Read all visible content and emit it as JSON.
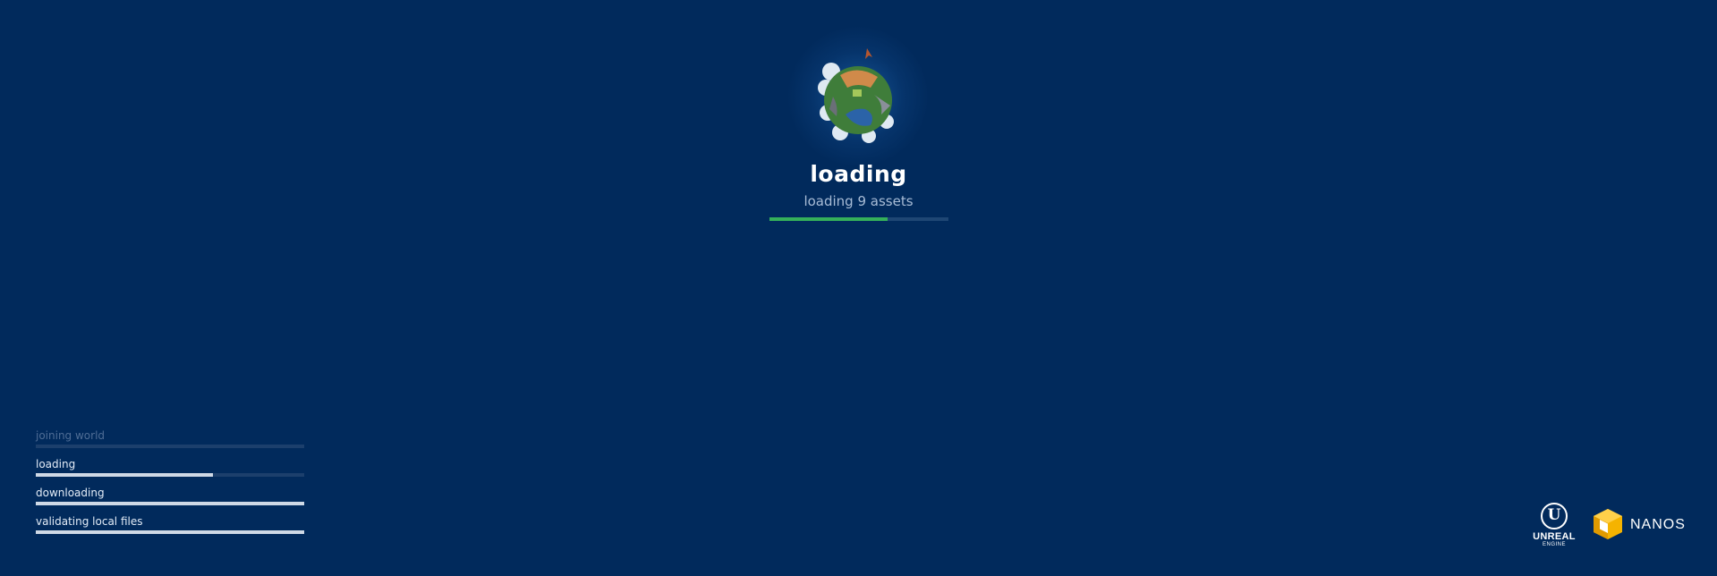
{
  "loading_screen": {
    "title": "loading",
    "subtitle": "loading 9 assets",
    "progress_fraction": 0.66,
    "progress_color": "#35b05a",
    "background_color": "#012a5c",
    "globe_icon": "world-globe-icon"
  },
  "steps": [
    {
      "label": "joining world",
      "progress_fraction": 0.0,
      "state": "pending"
    },
    {
      "label": "loading",
      "progress_fraction": 0.66,
      "state": "active"
    },
    {
      "label": "downloading",
      "progress_fraction": 1.0,
      "state": "done"
    },
    {
      "label": "validating local files",
      "progress_fraction": 1.0,
      "state": "done"
    }
  ],
  "logos": {
    "unreal": {
      "icon": "unreal-engine-logo-icon",
      "glyph": "U",
      "word": "UNREAL",
      "sub": "ENGINE"
    },
    "nanos": {
      "icon": "nanos-cube-logo-icon",
      "word": "NANOS",
      "color": "#f5b300"
    }
  }
}
